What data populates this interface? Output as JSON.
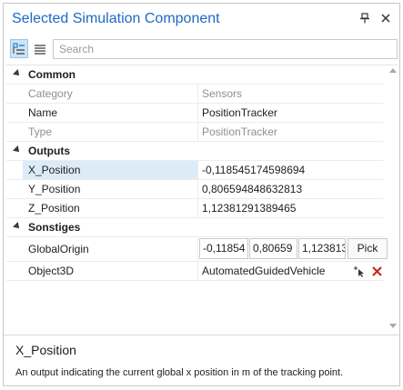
{
  "panel": {
    "title": "Selected Simulation Component"
  },
  "toolbar": {
    "categorized_icon": "categorized-view-icon",
    "alphabetical_icon": "alphabetical-view-icon",
    "search_placeholder": "Search"
  },
  "categories": {
    "common": "Common",
    "outputs": "Outputs",
    "sonstiges": "Sonstiges"
  },
  "properties": {
    "category": {
      "name": "Category",
      "value": "Sensors"
    },
    "name": {
      "name": "Name",
      "value": "PositionTracker"
    },
    "type": {
      "name": "Type",
      "value": "PositionTracker"
    },
    "x_position": {
      "name": "X_Position",
      "value": "-0,118545174598694"
    },
    "y_position": {
      "name": "Y_Position",
      "value": "0,806594848632813"
    },
    "z_position": {
      "name": "Z_Position",
      "value": "1,12381291389465"
    },
    "global_origin": {
      "name": "GlobalOrigin",
      "x": "-0,11854",
      "y": "0,80659",
      "z": "1,123813",
      "pick_label": "Pick"
    },
    "object3d": {
      "name": "Object3D",
      "value": "AutomatedGuidedVehicle"
    }
  },
  "description": {
    "title": "X_Position",
    "text": "An output indicating the current global x position in m of the tracking point."
  },
  "colors": {
    "title": "#1c69c4",
    "selection": "#dcebf8",
    "delete": "#c42b1c"
  }
}
